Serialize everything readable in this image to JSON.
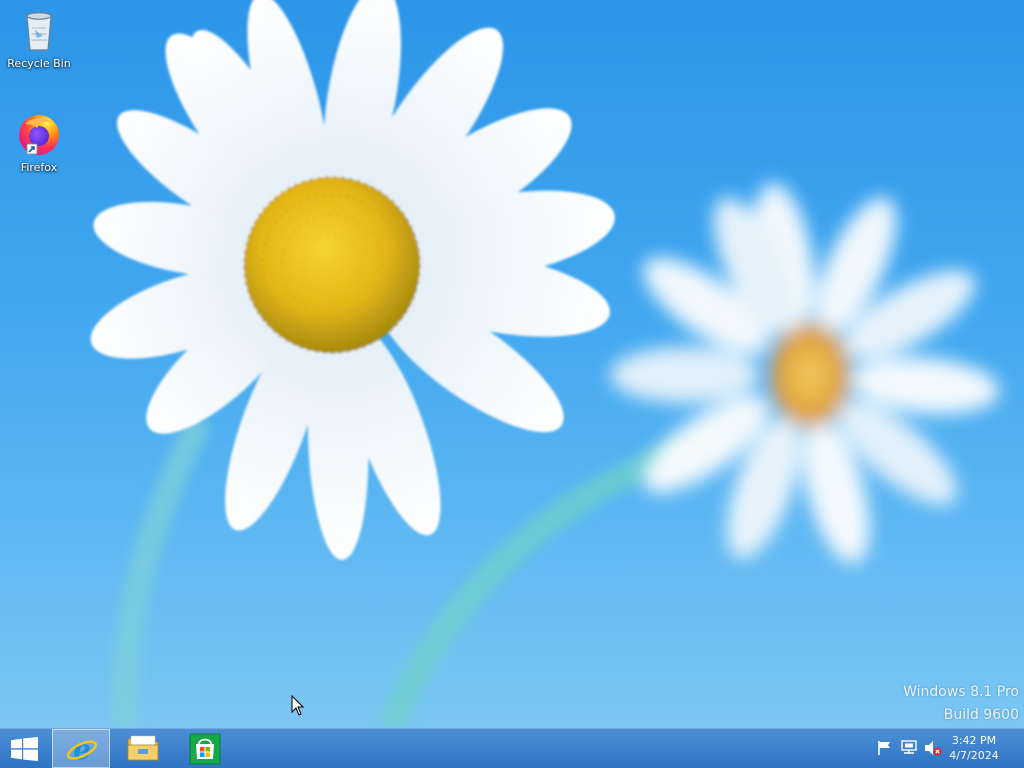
{
  "desktop": {
    "icons": [
      {
        "label": "Recycle Bin",
        "icon": "recycle-bin-icon"
      },
      {
        "label": "Firefox",
        "icon": "firefox-icon"
      }
    ]
  },
  "watermark": {
    "line1": "Windows 8.1 Pro",
    "line2": "Build 9600"
  },
  "taskbar": {
    "pinned": [
      {
        "name": "Internet Explorer",
        "icon": "internet-explorer-icon",
        "active": true
      },
      {
        "name": "File Explorer",
        "icon": "file-explorer-icon",
        "active": false
      },
      {
        "name": "Store",
        "icon": "store-icon",
        "active": false
      }
    ],
    "tray": {
      "icons": [
        "action-center-flag-icon",
        "network-icon",
        "volume-muted-icon"
      ],
      "time": "3:42 PM",
      "date": "4/7/2024"
    }
  },
  "colors": {
    "taskbar": "#3a80cc",
    "desktop_sky": "#3fa6ef",
    "flower_center": "#e7b41a",
    "firefox_orange": "#ff7139"
  }
}
